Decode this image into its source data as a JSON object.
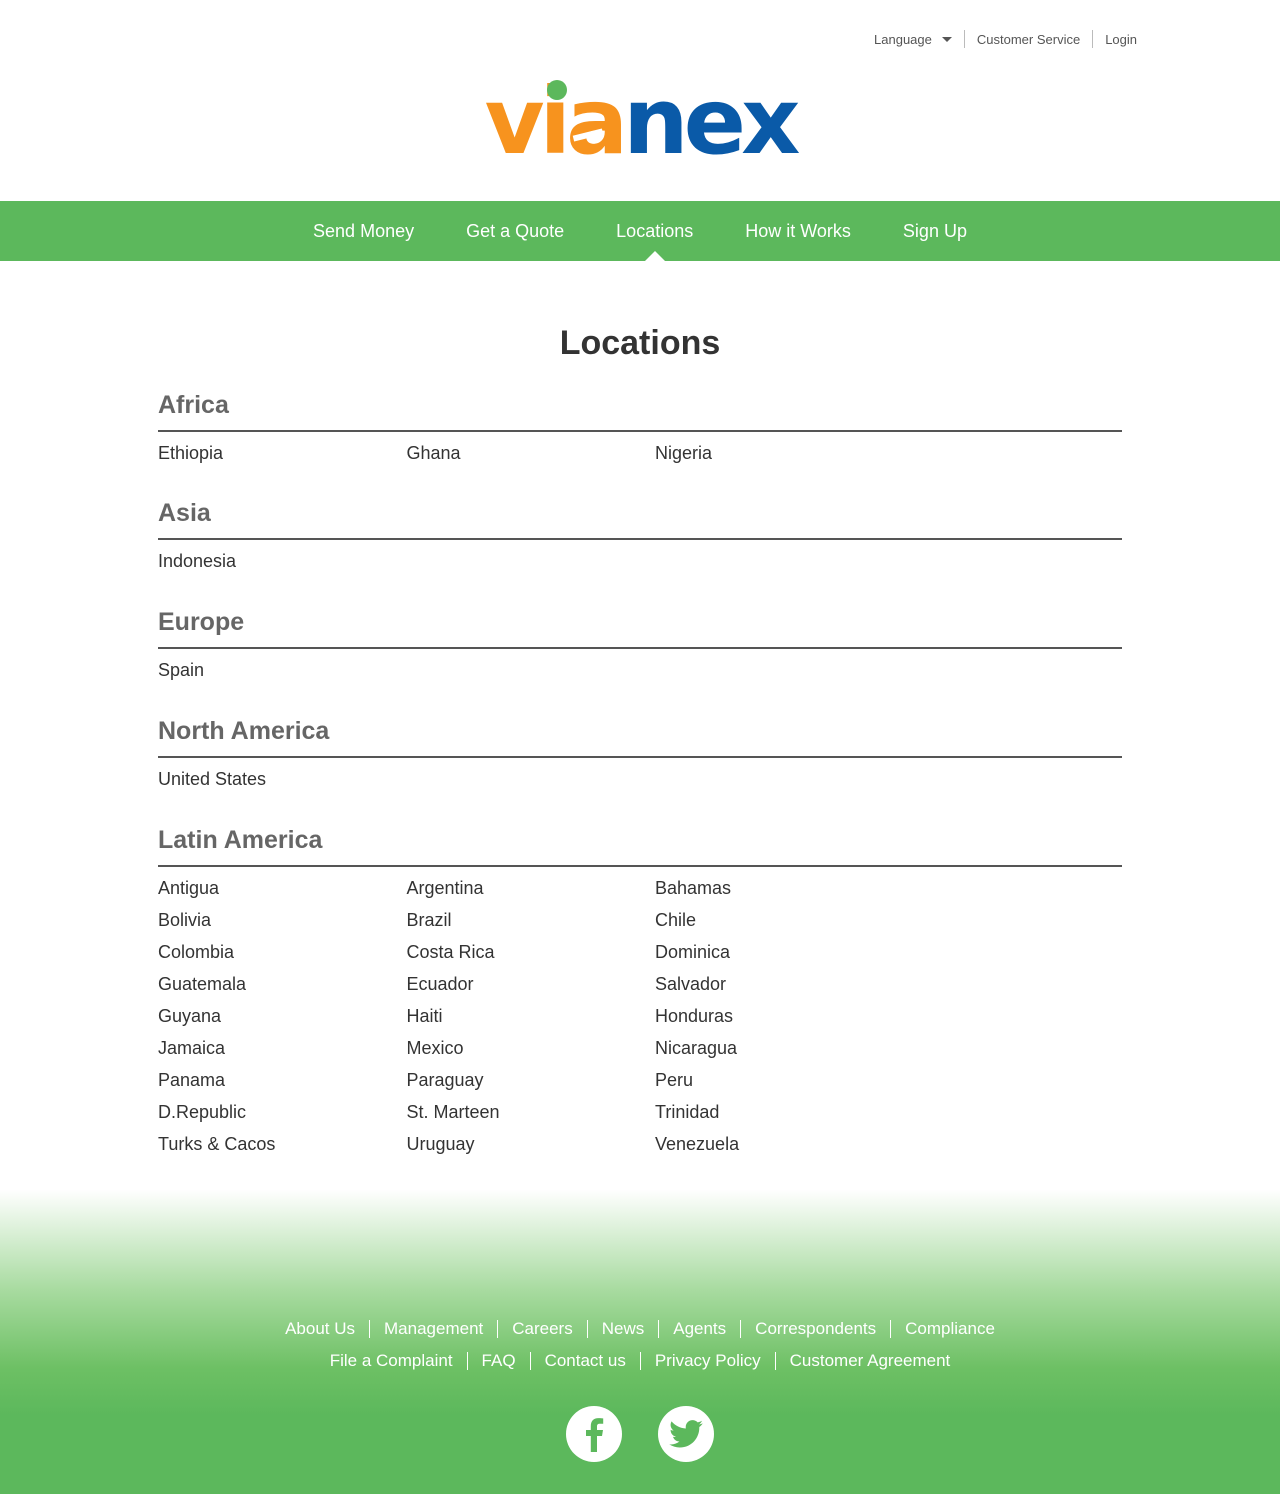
{
  "topbar": {
    "language": "Language",
    "customer_service": "Customer Service",
    "login": "Login"
  },
  "logo": {
    "part1": "via",
    "part2": "nex",
    "brand_orange": "#f7931e",
    "brand_blue": "#0a5aa8"
  },
  "nav": {
    "items": [
      "Send Money",
      "Get a Quote",
      "Locations",
      "How it Works",
      "Sign Up"
    ],
    "active": "Locations",
    "color": "#5cb85c"
  },
  "page_title": "Locations",
  "regions": [
    {
      "name": "Africa",
      "countries": [
        "Ethiopia",
        "Ghana",
        "Nigeria"
      ]
    },
    {
      "name": "Asia",
      "countries": [
        "Indonesia"
      ]
    },
    {
      "name": "Europe",
      "countries": [
        "Spain"
      ]
    },
    {
      "name": "North America",
      "countries": [
        "United States"
      ]
    },
    {
      "name": "Latin America",
      "countries": [
        "Antigua",
        "Argentina",
        "Bahamas",
        "Bolivia",
        "Brazil",
        "Chile",
        "Colombia",
        "Costa Rica",
        "Dominica",
        "Guatemala",
        "Ecuador",
        "Salvador",
        "Guyana",
        "Haiti",
        "Honduras",
        "Jamaica",
        "Mexico",
        "Nicaragua",
        "Panama",
        "Paraguay",
        "Peru",
        "D.Republic",
        "St. Marteen",
        "Trinidad",
        "Turks & Cacos",
        "Uruguay",
        "Venezuela"
      ]
    }
  ],
  "footer": {
    "row1": [
      "About Us",
      "Management",
      "Careers",
      "News",
      "Agents",
      "Correspondents",
      "Compliance"
    ],
    "row2": [
      "File a Complaint",
      "FAQ",
      "Contact us",
      "Privacy Policy",
      "Customer Agreement"
    ],
    "social": [
      "facebook-icon",
      "twitter-icon"
    ]
  }
}
